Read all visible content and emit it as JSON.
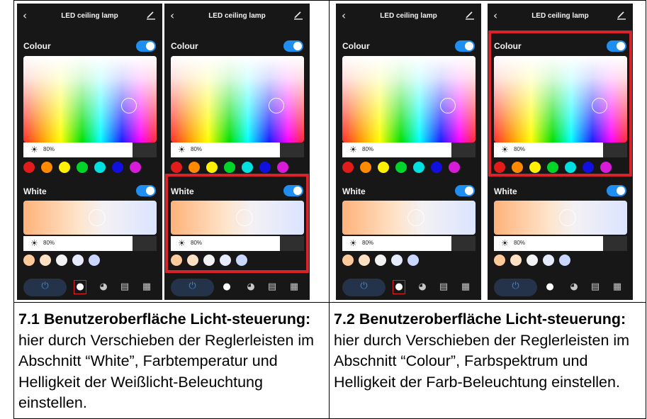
{
  "screens": {
    "app_title": "LED ceiling lamp",
    "colour_label": "Colour",
    "white_label": "White",
    "brightness_value": "80%"
  },
  "colour_swatches": [
    "#e21b1b",
    "#ff8a00",
    "#fff200",
    "#00d62a",
    "#00e0e0",
    "#1010e0",
    "#d81bd8"
  ],
  "white_swatches": [
    "#ffc99a",
    "#ffe0c2",
    "#f3f2f4",
    "#e6ecff",
    "#c9d6ff"
  ],
  "colors": {
    "accent": "#1e8ff0",
    "highlight": "#d9232a",
    "background": "#171717"
  },
  "icons": [
    "back-arrow-icon",
    "edit-pencil-icon",
    "power-icon",
    "bulb-icon",
    "palette-icon",
    "scene-icon",
    "grid-icon",
    "sun-icon"
  ],
  "captions": [
    {
      "heading": "7.1  Benutzeroberfläche Licht-steuerung:",
      "body": " hier durch Verschieben der Reglerleisten im Abschnitt “White”, Farbtemperatur und Helligkeit der Weißlicht-Beleuchtung einstellen."
    },
    {
      "heading": "7.2  Benutzeroberfläche Licht-steuerung:",
      "body": " hier durch Verschieben der Reglerleisten im Abschnitt “Colour”, Farbspektrum und Helligkeit der Farb-Beleuchtung einstellen."
    }
  ]
}
